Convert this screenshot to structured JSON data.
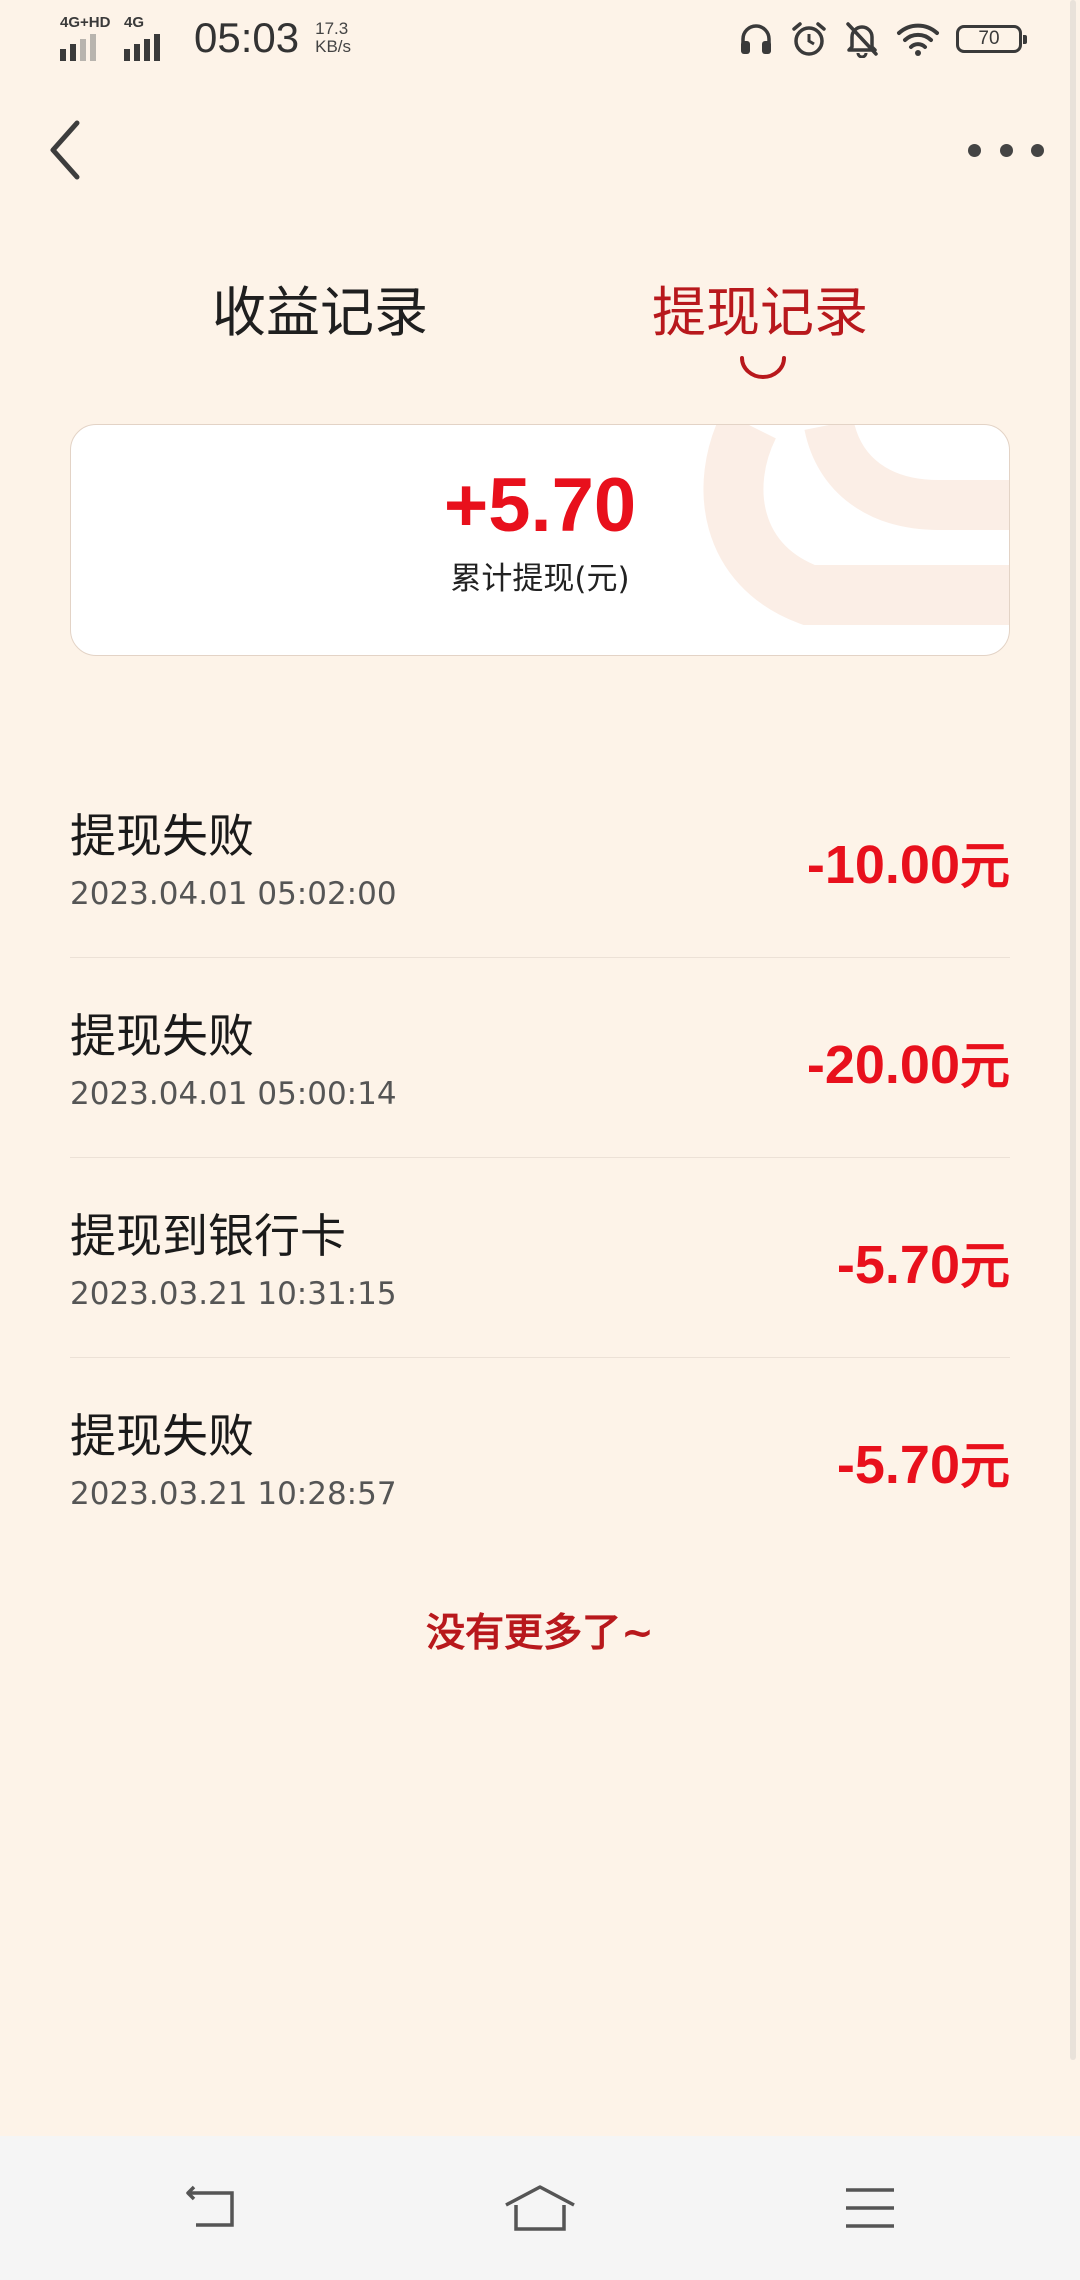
{
  "status_bar": {
    "sim1_label": "4G+HD",
    "sim2_label": "4G",
    "time": "05:03",
    "speed_value": "17.3",
    "speed_unit": "KB/s",
    "icons": [
      "headphones-icon",
      "alarm-icon",
      "bell-off-icon",
      "wifi-icon"
    ],
    "battery": "70"
  },
  "nav": {
    "back_icon": "chevron-left-icon",
    "more_icon": "more-dots-icon"
  },
  "tabs": [
    {
      "label": "收益记录",
      "active": false
    },
    {
      "label": "提现记录",
      "active": true
    }
  ],
  "summary": {
    "amount": "+5.70",
    "label": "累计提现(元)"
  },
  "records": [
    {
      "title": "提现失败",
      "time": "2023.04.01 05:02:00",
      "amount": "-10.00",
      "unit": "元"
    },
    {
      "title": "提现失败",
      "time": "2023.04.01 05:00:14",
      "amount": "-20.00",
      "unit": "元"
    },
    {
      "title": "提现到银行卡",
      "time": "2023.03.21 10:31:15",
      "amount": "-5.70",
      "unit": "元"
    },
    {
      "title": "提现失败",
      "time": "2023.03.21 10:28:57",
      "amount": "-5.70",
      "unit": "元"
    }
  ],
  "footer_text": "没有更多了~",
  "bottom_nav": [
    "back-nav-icon",
    "home-nav-icon",
    "menu-nav-icon"
  ],
  "colors": {
    "background": "#fdf3e8",
    "accent_red": "#e8101c",
    "tab_active": "#b8181c"
  }
}
